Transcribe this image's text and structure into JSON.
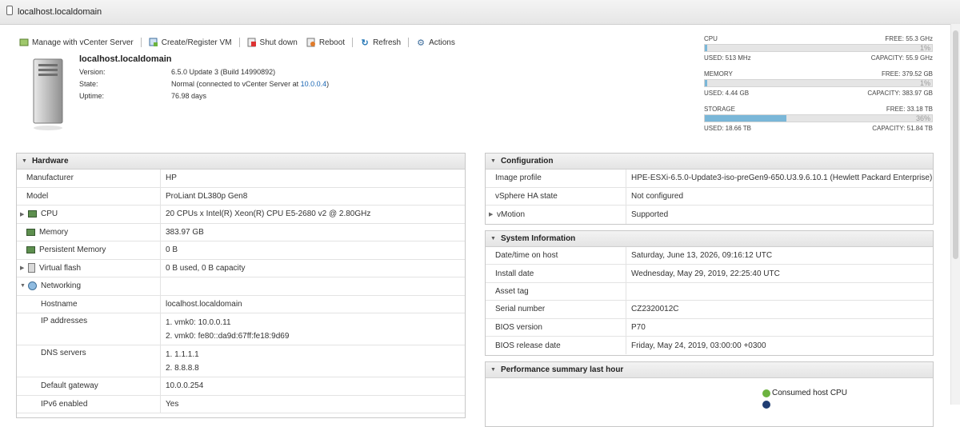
{
  "window": {
    "title": "localhost.localdomain"
  },
  "toolbar": {
    "manage": "Manage with vCenter Server",
    "create": "Create/Register VM",
    "shutdown": "Shut down",
    "reboot": "Reboot",
    "refresh": "Refresh",
    "actions": "Actions"
  },
  "host": {
    "name": "localhost.localdomain",
    "version_label": "Version:",
    "version": "6.5.0 Update 3 (Build 14990892)",
    "state_label": "State:",
    "state_prefix": "Normal (connected to vCenter Server at",
    "state_link": "10.0.0.4",
    "state_suffix": ")",
    "uptime_label": "Uptime:",
    "uptime": "76.98 days"
  },
  "resources": {
    "cpu": {
      "name": "CPU",
      "free": "FREE: 55.3 GHz",
      "pct": "1%",
      "percent": 1,
      "used": "USED: 513 MHz",
      "capacity": "CAPACITY: 55.9 GHz"
    },
    "memory": {
      "name": "MEMORY",
      "free": "FREE: 379.52 GB",
      "pct": "1%",
      "percent": 1,
      "used": "USED: 4.44 GB",
      "capacity": "CAPACITY: 383.97 GB"
    },
    "storage": {
      "name": "STORAGE",
      "free": "FREE: 33.18 TB",
      "pct": "36%",
      "percent": 36,
      "used": "USED: 18.66 TB",
      "capacity": "CAPACITY: 51.84 TB"
    }
  },
  "hardware": {
    "title": "Hardware",
    "rows": [
      {
        "label": "Manufacturer",
        "value": "HP"
      },
      {
        "label": "Model",
        "value": "ProLiant DL380p Gen8"
      },
      {
        "label": "CPU",
        "value": "20 CPUs x Intel(R) Xeon(R) CPU E5-2680 v2 @ 2.80GHz"
      },
      {
        "label": "Memory",
        "value": "383.97 GB"
      },
      {
        "label": "Persistent Memory",
        "value": "0 B"
      },
      {
        "label": "Virtual flash",
        "value": "0 B used, 0 B capacity"
      },
      {
        "label": "Networking",
        "value": ""
      },
      {
        "label": "Hostname",
        "value": "localhost.localdomain"
      },
      {
        "label": "IP addresses",
        "value": "1. vmk0: 10.0.0.11",
        "value2": "2. vmk0: fe80::da9d:67ff:fe18:9d69"
      },
      {
        "label": "DNS servers",
        "value": "1. 1.1.1.1",
        "value2": "2. 8.8.8.8"
      },
      {
        "label": "Default gateway",
        "value": "10.0.0.254"
      },
      {
        "label": "IPv6 enabled",
        "value": "Yes"
      }
    ]
  },
  "configuration": {
    "title": "Configuration",
    "rows": [
      {
        "label": "Image profile",
        "value": "HPE-ESXi-6.5.0-Update3-iso-preGen9-650.U3.9.6.10.1 (Hewlett Packard Enterprise)"
      },
      {
        "label": "vSphere HA state",
        "value": "Not configured"
      },
      {
        "label": "vMotion",
        "value": "Supported"
      }
    ]
  },
  "sysinfo": {
    "title": "System Information",
    "rows": [
      {
        "label": "Date/time on host",
        "value": "Saturday, June 13, 2026, 09:16:12 UTC"
      },
      {
        "label": "Install date",
        "value": "Wednesday, May 29, 2019, 22:25:40 UTC"
      },
      {
        "label": "Asset tag",
        "value": ""
      },
      {
        "label": "Serial number",
        "value": "CZ2320012C"
      },
      {
        "label": "BIOS version",
        "value": "P70"
      },
      {
        "label": "BIOS release date",
        "value": "Friday, May 24, 2019, 03:00:00 +0300"
      }
    ]
  },
  "performance": {
    "title": "Performance summary last hour",
    "legend1": "Consumed host CPU",
    "legend1_color": "#6cb33f",
    "legend2_color": "#1f3d73"
  }
}
